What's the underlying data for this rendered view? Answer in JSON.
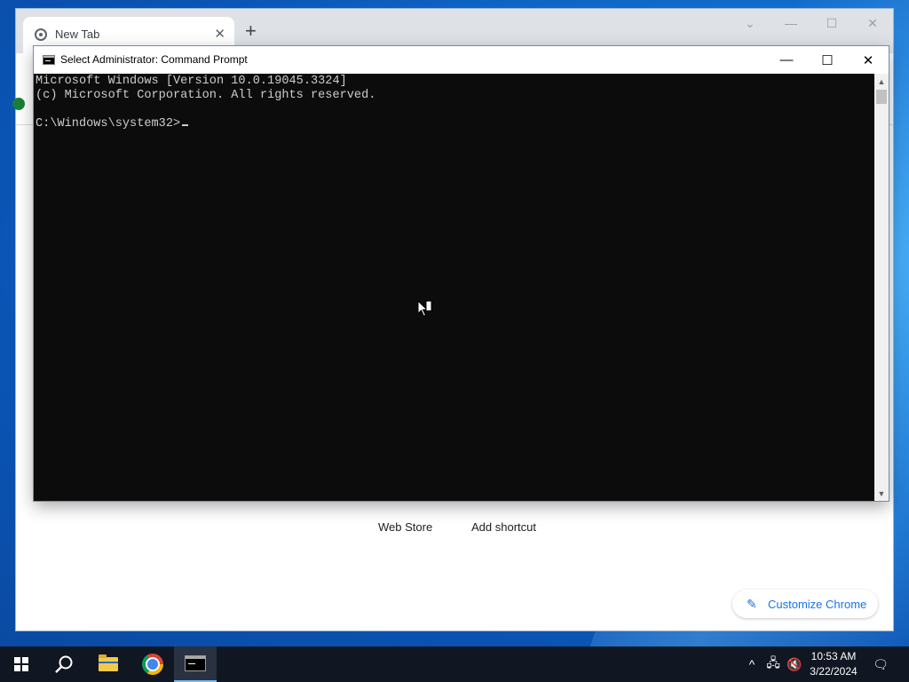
{
  "chrome": {
    "tab_title": "New Tab",
    "tab_close": "✕",
    "new_tab": "+",
    "controls": [
      "⌄",
      "—",
      "☐",
      "✕"
    ],
    "shortcuts": [
      "Web Store",
      "Add shortcut"
    ],
    "customize_label": "Customize Chrome",
    "customize_icon": "pencil-icon"
  },
  "cmd": {
    "title": "Select Administrator: Command Prompt",
    "controls": {
      "minimize": "—",
      "maximize": "☐",
      "close": "✕"
    },
    "lines": [
      "Microsoft Windows [Version 10.0.19045.3324]",
      "(c) Microsoft Corporation. All rights reserved.",
      "",
      "C:\\Windows\\system32>"
    ],
    "scroll": {
      "up": "▲",
      "down": "▼"
    }
  },
  "taskbar": {
    "apps": [
      "start",
      "search",
      "file-explorer",
      "chrome",
      "command-prompt"
    ],
    "active_app": "command-prompt",
    "tray": {
      "chevron": "^",
      "network": "🖧",
      "volume": "🔇"
    },
    "time": "10:53 AM",
    "date": "3/22/2024",
    "notifications": "🗨"
  },
  "colors": {
    "console_bg": "#0c0c0c",
    "console_text": "#cccccc",
    "taskbar_bg": "#101622",
    "accent": "#1a73e8"
  }
}
